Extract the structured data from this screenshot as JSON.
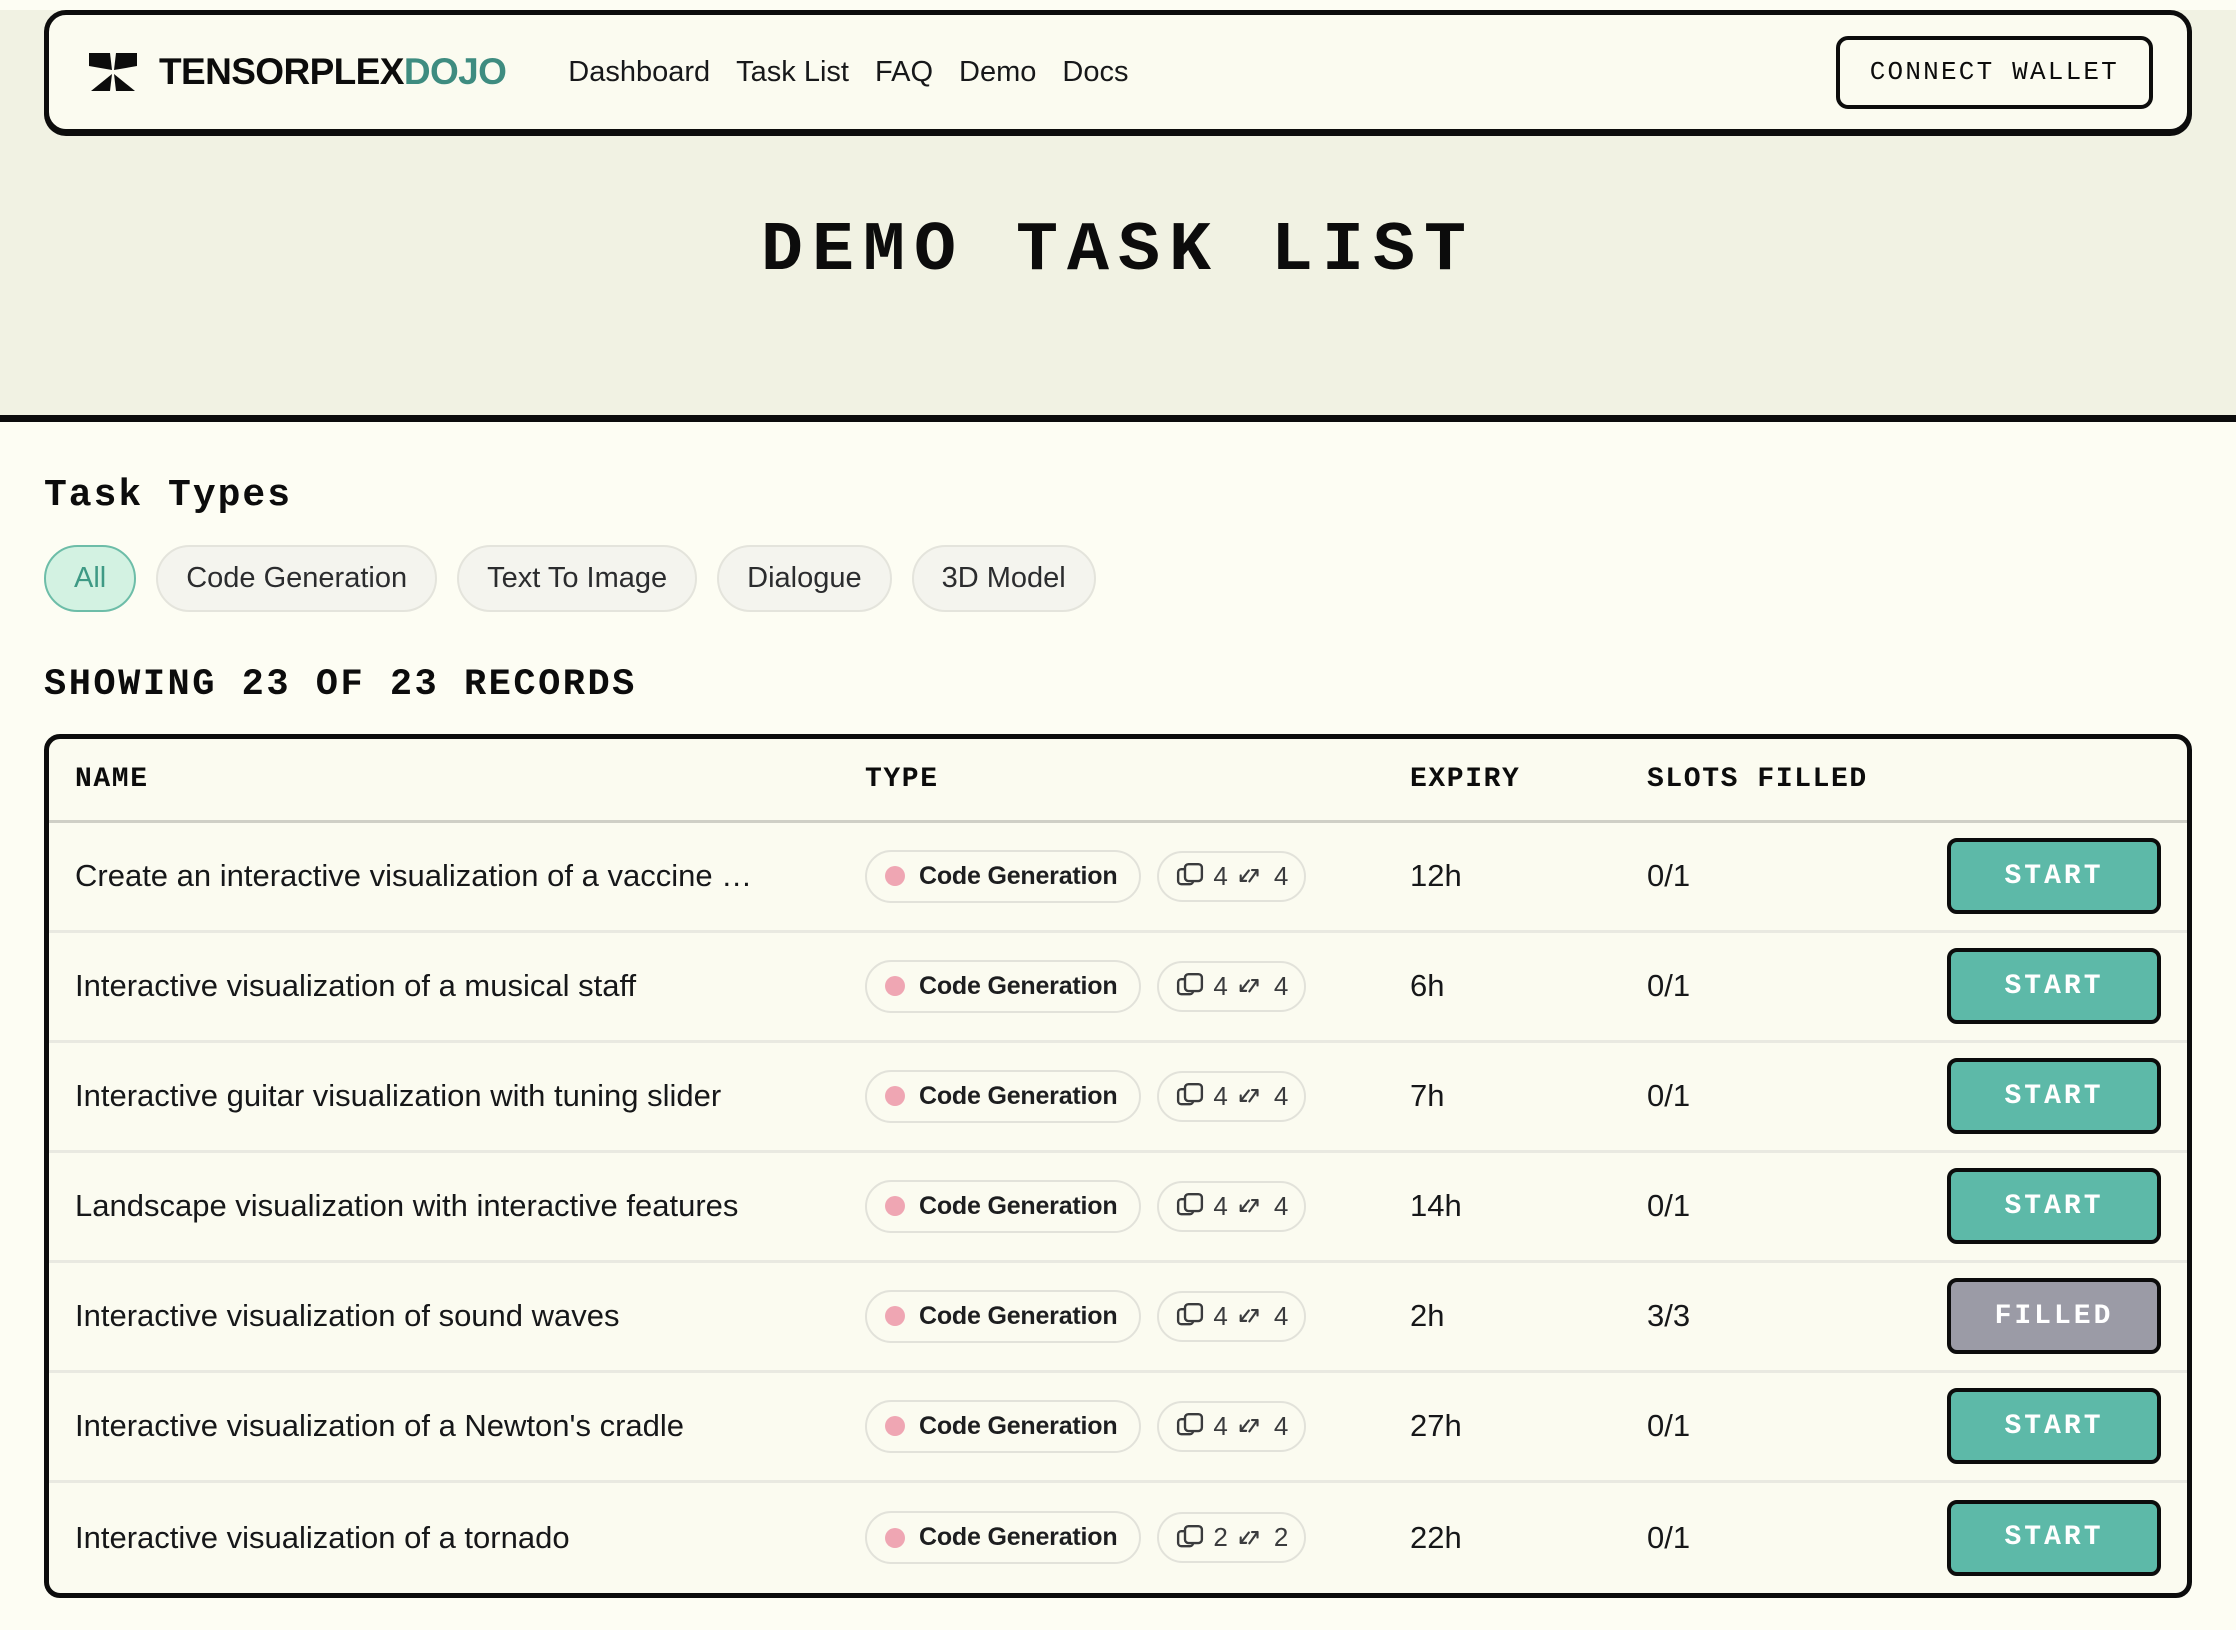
{
  "header": {
    "brand_primary": "TENSORPLEX",
    "brand_secondary": "DOJO",
    "brand_accent_color": "#3e8c80",
    "nav": [
      {
        "label": "Dashboard"
      },
      {
        "label": "Task List"
      },
      {
        "label": "FAQ"
      },
      {
        "label": "Demo"
      },
      {
        "label": "Docs"
      }
    ],
    "wallet_button": "CONNECT WALLET"
  },
  "page": {
    "title": "DEMO TASK LIST",
    "band_background": "#f1f2e3",
    "body_background": "#fdfdf3"
  },
  "filters": {
    "section_title": "Task Types",
    "options": [
      {
        "label": "All",
        "selected": true
      },
      {
        "label": "Code Generation",
        "selected": false
      },
      {
        "label": "Text To Image",
        "selected": false
      },
      {
        "label": "Dialogue",
        "selected": false
      },
      {
        "label": "3D Model",
        "selected": false
      }
    ],
    "active_background": "#d3f2e2",
    "active_text_color": "#3e9a85"
  },
  "records_summary": "SHOWING 23 OF 23 RECORDS",
  "table": {
    "columns": [
      "NAME",
      "TYPE",
      "EXPIRY",
      "SLOTS FILLED"
    ],
    "rows": [
      {
        "name": "Create an interactive visualization of a vaccine …",
        "type": "Code Generation",
        "type_dot_color": "#efa6b3",
        "stack_count": "4",
        "swap_count": "4",
        "expiry": "12h",
        "slots": "0/1",
        "action": "START",
        "action_state": "start"
      },
      {
        "name": "Interactive visualization of a musical staff",
        "type": "Code Generation",
        "type_dot_color": "#efa6b3",
        "stack_count": "4",
        "swap_count": "4",
        "expiry": "6h",
        "slots": "0/1",
        "action": "START",
        "action_state": "start"
      },
      {
        "name": "Interactive guitar visualization with tuning slider",
        "type": "Code Generation",
        "type_dot_color": "#efa6b3",
        "stack_count": "4",
        "swap_count": "4",
        "expiry": "7h",
        "slots": "0/1",
        "action": "START",
        "action_state": "start"
      },
      {
        "name": "Landscape visualization with interactive features",
        "type": "Code Generation",
        "type_dot_color": "#efa6b3",
        "stack_count": "4",
        "swap_count": "4",
        "expiry": "14h",
        "slots": "0/1",
        "action": "START",
        "action_state": "start"
      },
      {
        "name": "Interactive visualization of sound waves",
        "type": "Code Generation",
        "type_dot_color": "#efa6b3",
        "stack_count": "4",
        "swap_count": "4",
        "expiry": "2h",
        "slots": "3/3",
        "action": "FILLED",
        "action_state": "filled"
      },
      {
        "name": "Interactive visualization of a Newton's cradle",
        "type": "Code Generation",
        "type_dot_color": "#efa6b3",
        "stack_count": "4",
        "swap_count": "4",
        "expiry": "27h",
        "slots": "0/1",
        "action": "START",
        "action_state": "start"
      },
      {
        "name": "Interactive visualization of a tornado",
        "type": "Code Generation",
        "type_dot_color": "#efa6b3",
        "stack_count": "2",
        "swap_count": "2",
        "expiry": "22h",
        "slots": "0/1",
        "action": "START",
        "action_state": "start"
      }
    ],
    "start_button_color": "#5db9a8",
    "filled_button_color": "#9b9ba6"
  }
}
